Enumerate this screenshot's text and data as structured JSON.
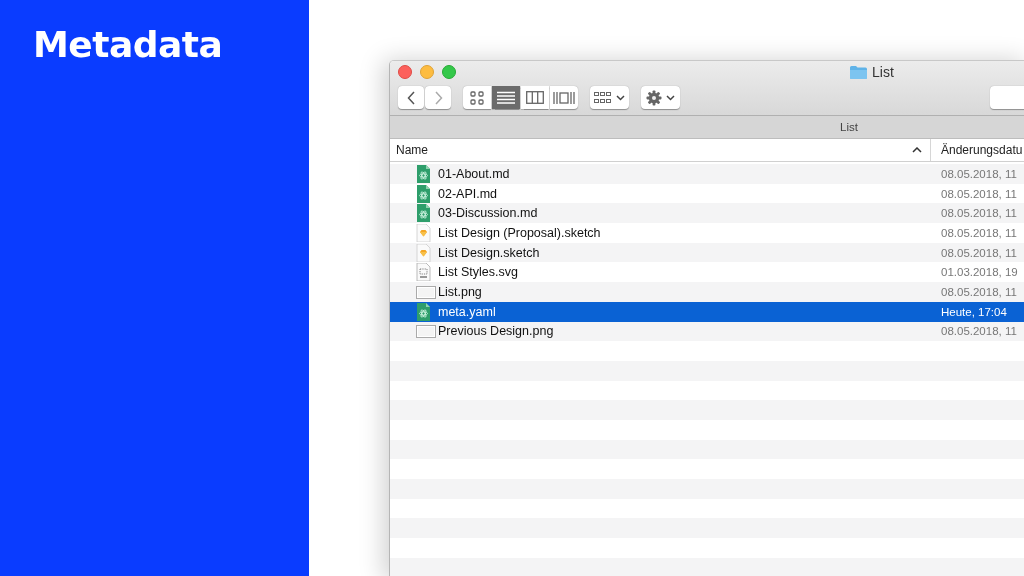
{
  "slide": {
    "title": "Metadata"
  },
  "window": {
    "title": "List",
    "path_bar": "List",
    "view_modes": [
      {
        "kind": "icons",
        "selected": false
      },
      {
        "kind": "list",
        "selected": true
      },
      {
        "kind": "columns",
        "selected": false
      },
      {
        "kind": "gallery",
        "selected": false
      }
    ],
    "columns": [
      "Name",
      "Änderungsdatu"
    ],
    "rows": [
      {
        "name": "01-About.md",
        "date": "08.05.2018, 11",
        "kind": "code",
        "selected": false
      },
      {
        "name": "02-API.md",
        "date": "08.05.2018, 11",
        "kind": "code",
        "selected": false
      },
      {
        "name": "03-Discussion.md",
        "date": "08.05.2018, 11",
        "kind": "code",
        "selected": false
      },
      {
        "name": "List Design (Proposal).sketch",
        "date": "08.05.2018, 11",
        "kind": "sketch",
        "selected": false
      },
      {
        "name": "List Design.sketch",
        "date": "08.05.2018, 11",
        "kind": "sketch",
        "selected": false
      },
      {
        "name": "List Styles.svg",
        "date": "01.03.2018, 19",
        "kind": "svg",
        "selected": false
      },
      {
        "name": "List.png",
        "date": "08.05.2018, 11",
        "kind": "image",
        "selected": false
      },
      {
        "name": "meta.yaml",
        "date": "Heute, 17:04",
        "kind": "code",
        "selected": true
      },
      {
        "name": "Previous Design.png",
        "date": "08.05.2018, 11",
        "kind": "image",
        "selected": false
      }
    ]
  }
}
